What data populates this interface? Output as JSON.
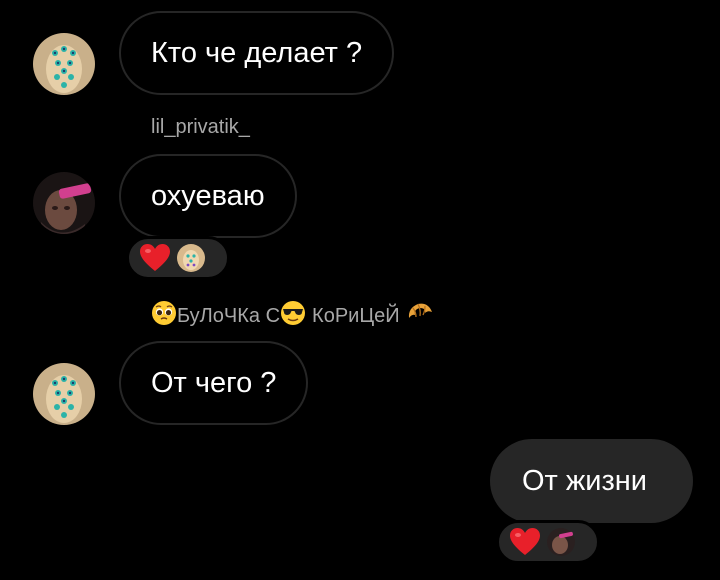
{
  "messages": [
    {
      "id": "m1",
      "direction": "incoming",
      "text": "Кто че делает ?"
    },
    {
      "id": "m2",
      "direction": "incoming",
      "sender": "lil_privatik_",
      "text": "охуеваю",
      "reactions": [
        "heart-icon",
        "reactor-avatar"
      ]
    },
    {
      "id": "m3",
      "direction": "incoming",
      "sender_parts": [
        "БуЛоЧКа С",
        "КоРиЦеЙ"
      ],
      "text": "От чего ?"
    },
    {
      "id": "m4",
      "direction": "outgoing",
      "text": "От жизни",
      "reactions": [
        "heart-icon",
        "reactor-avatar"
      ]
    }
  ],
  "colors": {
    "background": "#000000",
    "bubble_border": "#262626",
    "outgoing_bubble": "#262626",
    "sender_name": "#a8a8a8",
    "heart": "#e8202a"
  }
}
